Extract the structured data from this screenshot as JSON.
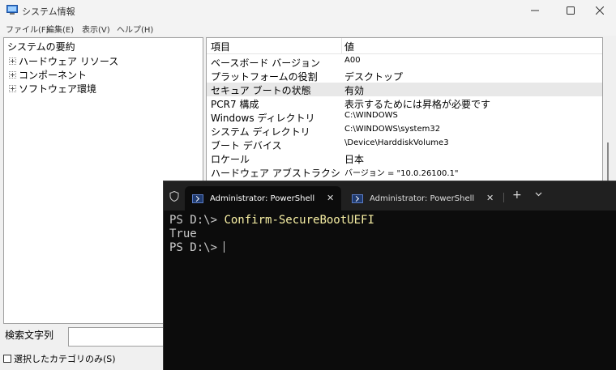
{
  "sysinfo": {
    "title": "システム情報",
    "menu": [
      "ファイル(F)",
      "編集(E)",
      "表示(V)",
      "ヘルプ(H)"
    ],
    "tree": {
      "root": "システムの要約",
      "children": [
        "ハードウェア リソース",
        "コンポーネント",
        "ソフトウェア環境"
      ]
    },
    "list": {
      "header_item": "項目",
      "header_value": "値",
      "rows": [
        {
          "item": "ベースボード バージョン",
          "value": "A00"
        },
        {
          "item": "プラットフォームの役割",
          "value": "デスクトップ"
        },
        {
          "item": "セキュア ブートの状態",
          "value": "有効"
        },
        {
          "item": "PCR7 構成",
          "value": "表示するためには昇格が必要です"
        },
        {
          "item": "Windows ディレクトリ",
          "value": "C:\\WINDOWS"
        },
        {
          "item": "システム ディレクトリ",
          "value": "C:\\WINDOWS\\system32"
        },
        {
          "item": "ブート デバイス",
          "value": "\\Device\\HarddiskVolume3"
        },
        {
          "item": "ロケール",
          "value": "日本"
        },
        {
          "item": "ハードウェア アブストラクション ...",
          "value": "バージョン = \"10.0.26100.1\""
        }
      ]
    },
    "search_label": "検索文字列",
    "search_value": "",
    "checkbox_label": "選択したカテゴリのみ(S)"
  },
  "terminal": {
    "tabs": [
      {
        "title": "Administrator: PowerShell",
        "active": true
      },
      {
        "title": "Administrator: PowerShell",
        "active": false
      }
    ],
    "lines": [
      {
        "prompt": "PS D:\\> ",
        "command": "Confirm-SecureBootUEFI"
      },
      {
        "output": "True"
      },
      {
        "prompt": "PS D:\\> "
      }
    ]
  }
}
